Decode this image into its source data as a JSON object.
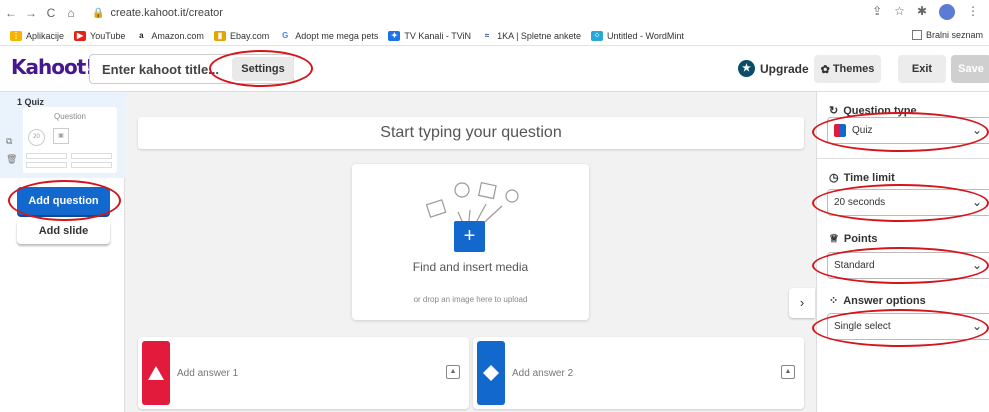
{
  "browser": {
    "url": "create.kahoot.it/creator",
    "bookmarks": [
      {
        "label": "Aplikacije",
        "icon": "apps-grid-icon",
        "color": "#f4b400"
      },
      {
        "label": "YouTube",
        "icon": "youtube-icon",
        "color": "#e62117"
      },
      {
        "label": "Amazon.com",
        "icon": "amazon-icon",
        "color": "#222222"
      },
      {
        "label": "Ebay.com",
        "icon": "ebay-icon",
        "color": "#e4a400"
      },
      {
        "label": "Adopt me mega pets",
        "icon": "google-icon",
        "color": "#4285f4"
      },
      {
        "label": "TV Kanali - TViN",
        "icon": "tvin-icon",
        "color": "#1a73e8"
      },
      {
        "label": "1KA | Spletne ankete",
        "icon": "1ka-icon",
        "color": "#1b3a8c"
      },
      {
        "label": "Untitled - WordMint",
        "icon": "wordmint-icon",
        "color": "#2aa6d9"
      }
    ],
    "bookmarks_right": "Bralni seznam"
  },
  "header": {
    "logo": "Kahoot!",
    "title_placeholder": "Enter kahoot title...",
    "settings_label": "Settings",
    "upgrade_label": "Upgrade",
    "themes_label": "Themes",
    "exit_label": "Exit",
    "save_label": "Save"
  },
  "sidebar": {
    "slide_number": "1 Quiz",
    "thumb_question": "Question",
    "thumb_timer": "20",
    "add_question_label": "Add question",
    "add_slide_label": "Add slide"
  },
  "editor": {
    "question_placeholder": "Start typing your question",
    "media_title": "Find and insert media",
    "media_sub": "or drop an image here to upload",
    "answers": [
      {
        "placeholder": "Add answer 1",
        "color": "#e21b3c",
        "shape": "triangle"
      },
      {
        "placeholder": "Add answer 2",
        "color": "#1368ce",
        "shape": "diamond"
      }
    ]
  },
  "panel": {
    "question_type_heading": "Question type",
    "question_type_value": "Quiz",
    "time_limit_heading": "Time limit",
    "time_limit_value": "20 seconds",
    "points_heading": "Points",
    "points_value": "Standard",
    "answer_options_heading": "Answer options",
    "answer_options_value": "Single select"
  },
  "colors": {
    "brand": "#46178f",
    "primary_button": "#1368ce",
    "annotation": "#d5141b"
  }
}
